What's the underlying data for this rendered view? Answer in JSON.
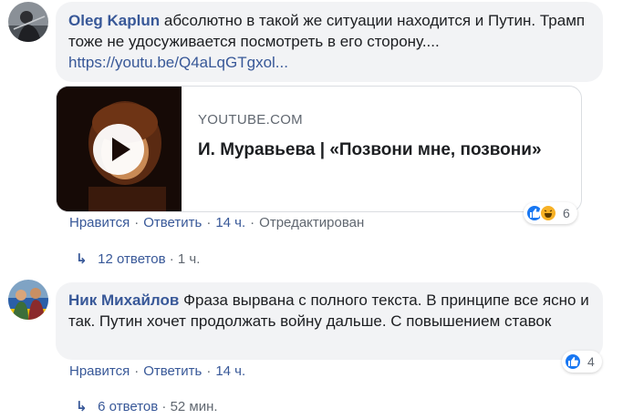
{
  "comments": [
    {
      "author": "Oleg Kaplun",
      "text": "абсолютно в такой же ситуации находится и Путин. Трамп тоже не удосуживается посмотреть в его сторону....",
      "link": "https://youtu.be/Q4aLqGTgxol...",
      "preview": {
        "domain": "YOUTUBE.COM",
        "title": "И. Муравьева | «Позвони мне, позвони»"
      },
      "actions": {
        "like": "Нравится",
        "reply": "Ответить",
        "time": "14 ч.",
        "edited": "Отредактирован"
      },
      "reactions": {
        "icons": [
          "like-icon",
          "haha-icon"
        ],
        "count": "6"
      },
      "replies": {
        "label": "12 ответов",
        "time": "1 ч."
      }
    },
    {
      "author": "Ник Михайлов",
      "text": "Фраза вырвана с полного текста. В принципе все ясно и так. Путин хочет продолжать войну дальше. С повышением ставок",
      "actions": {
        "like": "Нравится",
        "reply": "Ответить",
        "time": "14 ч."
      },
      "reactions": {
        "icons": [
          "like-icon"
        ],
        "count": "4"
      },
      "replies": {
        "label": "6 ответов",
        "time": "52 мин."
      }
    }
  ],
  "colors": {
    "link": "#385898",
    "bubble": "#f2f3f5",
    "meta": "#606770",
    "like_blue": "#1877f2",
    "haha_yellow": "#f7b125"
  }
}
